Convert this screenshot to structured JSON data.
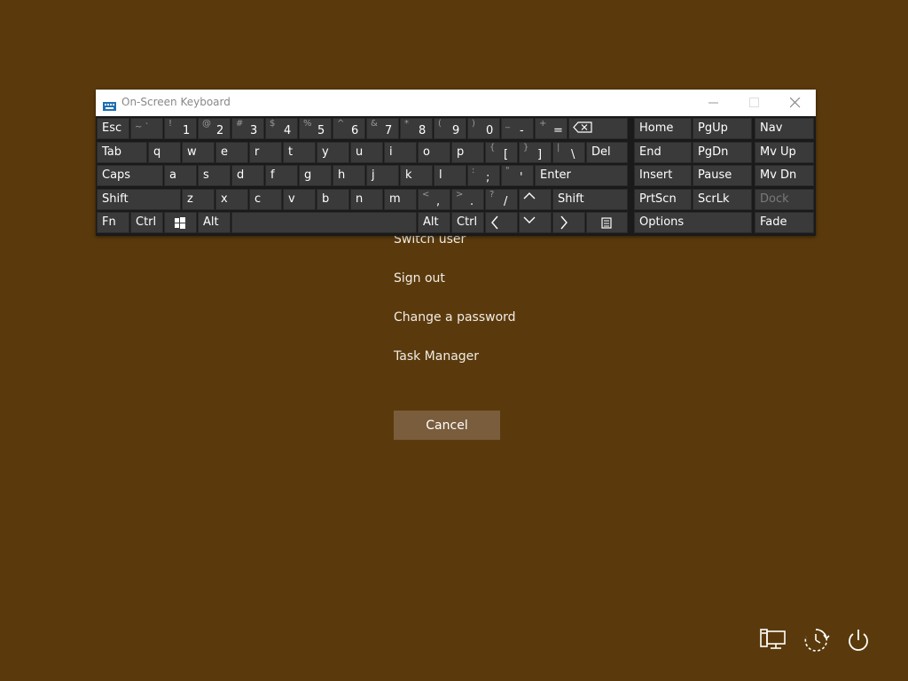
{
  "menu": {
    "items": [
      "Switch user",
      "Sign out",
      "Change a password",
      "Task Manager"
    ],
    "cancel_label": "Cancel"
  },
  "osk": {
    "title": "On-Screen Keyboard",
    "rows": [
      [
        {
          "main": "Esc"
        },
        {
          "shift": "~ `"
        },
        {
          "shift": "!",
          "low": "1"
        },
        {
          "shift": "@",
          "low": "2"
        },
        {
          "shift": "#",
          "low": "3"
        },
        {
          "shift": "$",
          "low": "4"
        },
        {
          "shift": "%",
          "low": "5"
        },
        {
          "shift": "^",
          "low": "6"
        },
        {
          "shift": "&",
          "low": "7"
        },
        {
          "shift": "*",
          "low": "8"
        },
        {
          "shift": "(",
          "low": "9"
        },
        {
          "shift": ")",
          "low": "0"
        },
        {
          "shift": "_",
          "low": "-"
        },
        {
          "shift": "+",
          "low": "="
        },
        {
          "icon": "backspace-icon"
        },
        {
          "main": "Home"
        },
        {
          "main": "PgUp"
        },
        {
          "main": "Nav"
        }
      ],
      [
        {
          "main": "Tab"
        },
        {
          "main": "q"
        },
        {
          "main": "w"
        },
        {
          "main": "e"
        },
        {
          "main": "r"
        },
        {
          "main": "t"
        },
        {
          "main": "y"
        },
        {
          "main": "u"
        },
        {
          "main": "i"
        },
        {
          "main": "o"
        },
        {
          "main": "p"
        },
        {
          "shift": "{",
          "low": "["
        },
        {
          "shift": "}",
          "low": "]"
        },
        {
          "shift": "|",
          "low": "\\"
        },
        {
          "main": "Del"
        },
        {
          "main": "End"
        },
        {
          "main": "PgDn"
        },
        {
          "main": "Mv Up"
        }
      ],
      [
        {
          "main": "Caps"
        },
        {
          "main": "a"
        },
        {
          "main": "s"
        },
        {
          "main": "d"
        },
        {
          "main": "f"
        },
        {
          "main": "g"
        },
        {
          "main": "h"
        },
        {
          "main": "j"
        },
        {
          "main": "k"
        },
        {
          "main": "l"
        },
        {
          "shift": ":",
          "low": ";"
        },
        {
          "shift": "\"",
          "low": "'"
        },
        {
          "main": "Enter"
        },
        {
          "main": "Insert"
        },
        {
          "main": "Pause"
        },
        {
          "main": "Mv Dn"
        }
      ],
      [
        {
          "main": "Shift"
        },
        {
          "main": "z"
        },
        {
          "main": "x"
        },
        {
          "main": "c"
        },
        {
          "main": "v"
        },
        {
          "main": "b"
        },
        {
          "main": "n"
        },
        {
          "main": "m"
        },
        {
          "shift": "<",
          "low": ","
        },
        {
          "shift": ">",
          "low": "."
        },
        {
          "shift": "?",
          "low": "/"
        },
        {
          "icon": "arrow-up-icon"
        },
        {
          "main": "Shift"
        },
        {
          "main": "PrtScn"
        },
        {
          "main": "ScrLk"
        },
        {
          "main": "Dock",
          "dim": true
        }
      ],
      [
        {
          "main": "Fn"
        },
        {
          "main": "Ctrl"
        },
        {
          "icon": "windows-logo-icon"
        },
        {
          "main": "Alt"
        },
        {
          "main": ""
        },
        {
          "main": "Alt"
        },
        {
          "main": "Ctrl"
        },
        {
          "icon": "arrow-left-icon"
        },
        {
          "icon": "arrow-down-icon"
        },
        {
          "icon": "arrow-right-icon"
        },
        {
          "icon": "menu-key-icon"
        },
        {
          "main": "Options"
        },
        {
          "main": "Fade"
        }
      ]
    ]
  },
  "system_icons": [
    "network-icon",
    "accessibility-icon",
    "power-icon"
  ]
}
